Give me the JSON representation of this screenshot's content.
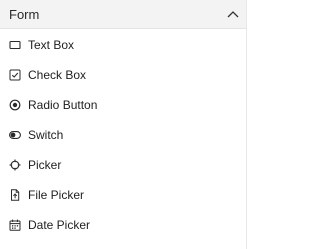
{
  "section": {
    "title": "Form",
    "expanded": true,
    "chevron_icon": "chevron-up-icon"
  },
  "items": [
    {
      "label": "Text Box",
      "icon": "text-box-icon"
    },
    {
      "label": "Check Box",
      "icon": "check-box-icon"
    },
    {
      "label": "Radio Button",
      "icon": "radio-button-icon"
    },
    {
      "label": "Switch",
      "icon": "switch-icon"
    },
    {
      "label": "Picker",
      "icon": "picker-icon"
    },
    {
      "label": "File Picker",
      "icon": "file-picker-icon"
    },
    {
      "label": "Date Picker",
      "icon": "date-picker-icon"
    }
  ],
  "colors": {
    "header_bg": "#f3f3f3",
    "text": "#1f1f1f",
    "icon": "#2b2b2b"
  }
}
